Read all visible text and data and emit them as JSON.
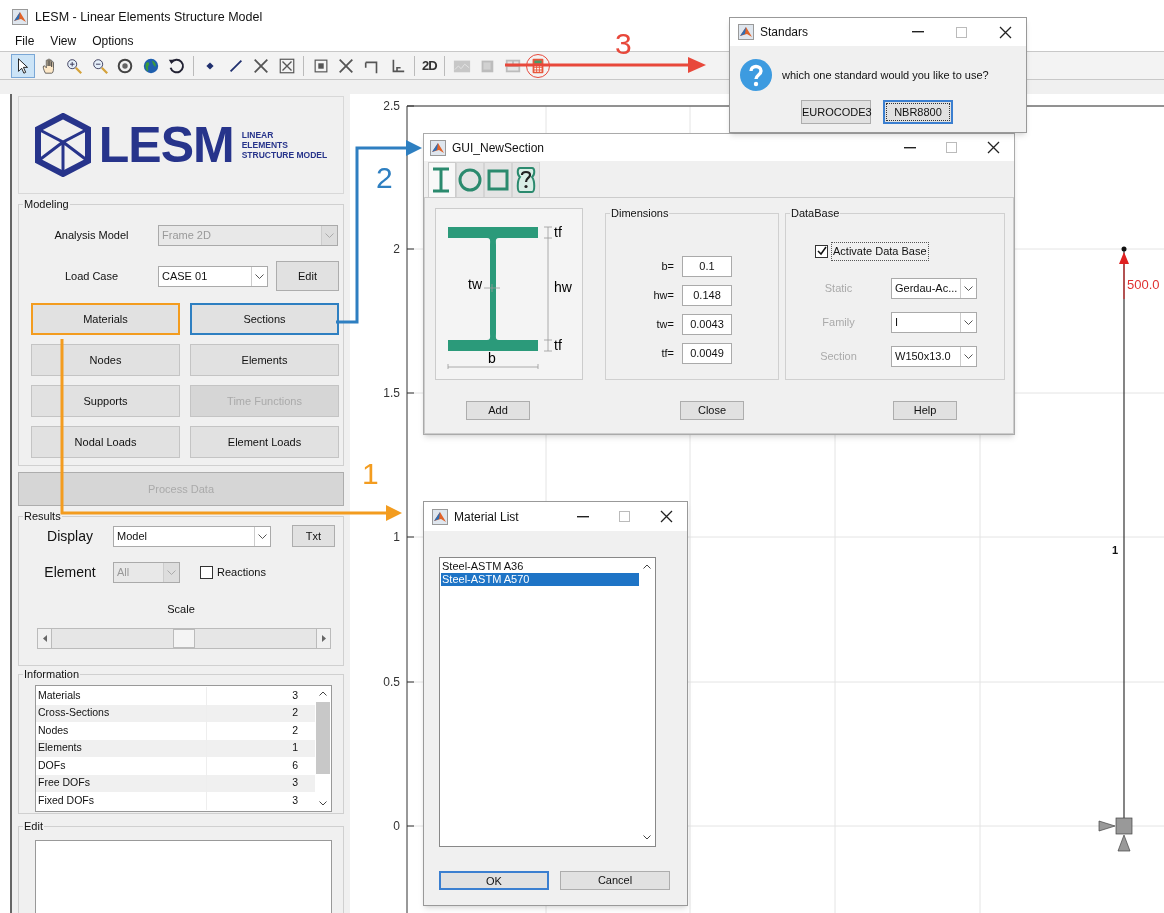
{
  "window": {
    "title": "LESM - Linear Elements Structure Model"
  },
  "menu": [
    "File",
    "View",
    "Options"
  ],
  "toolbar": [
    {
      "kind": "pointer",
      "selected": true,
      "disabled": false
    },
    {
      "kind": "pan",
      "selected": false,
      "disabled": false
    },
    {
      "kind": "zoom-in",
      "selected": false,
      "disabled": false
    },
    {
      "kind": "zoom-out",
      "selected": false,
      "disabled": false
    },
    {
      "kind": "rotate",
      "selected": false,
      "disabled": false
    },
    {
      "kind": "globe",
      "selected": false,
      "disabled": false
    },
    {
      "kind": "undo",
      "selected": false,
      "disabled": false
    },
    {
      "kind": "separator"
    },
    {
      "kind": "node",
      "selected": false,
      "disabled": false
    },
    {
      "kind": "line",
      "selected": false,
      "disabled": false
    },
    {
      "kind": "cross",
      "selected": false,
      "disabled": false
    },
    {
      "kind": "boxed-cross",
      "selected": false,
      "disabled": false
    },
    {
      "kind": "separator"
    },
    {
      "kind": "boxed-dot",
      "selected": false,
      "disabled": false
    },
    {
      "kind": "cross",
      "selected": false,
      "disabled": false
    },
    {
      "kind": "hinge",
      "selected": false,
      "disabled": false
    },
    {
      "kind": "fixed",
      "selected": false,
      "disabled": false
    },
    {
      "kind": "separator"
    },
    {
      "kind": "text",
      "label": "2D",
      "selected": false,
      "disabled": false
    },
    {
      "kind": "separator"
    },
    {
      "kind": "graph",
      "selected": false,
      "disabled": true
    },
    {
      "kind": "box",
      "selected": false,
      "disabled": true
    },
    {
      "kind": "panel",
      "selected": false,
      "disabled": true
    },
    {
      "kind": "calculator",
      "selected": false,
      "disabled": false
    }
  ],
  "logo": {
    "wordmark": "LESM",
    "tagline": [
      "LINEAR",
      "ELEMENTS",
      "STRUCTURE MODEL"
    ]
  },
  "modeling": {
    "title": "Modeling",
    "analysis_model": {
      "label": "Analysis Model",
      "value": "Frame 2D",
      "disabled": true
    },
    "load_case": {
      "label": "Load Case",
      "value": "CASE 01"
    },
    "edit_button": "Edit",
    "buttons": [
      {
        "label": "Materials",
        "disabled": false,
        "color": "#f39c1f"
      },
      {
        "label": "Sections",
        "disabled": false,
        "color": "#2e7fc1"
      },
      {
        "label": "Nodes",
        "disabled": false
      },
      {
        "label": "Elements",
        "disabled": false
      },
      {
        "label": "Supports",
        "disabled": false
      },
      {
        "label": "Time Functions",
        "disabled": true
      },
      {
        "label": "Nodal Loads",
        "disabled": false
      },
      {
        "label": "Element Loads",
        "disabled": false
      }
    ]
  },
  "process_button": {
    "label": "Process Data",
    "disabled": true
  },
  "results": {
    "title": "Results",
    "display": {
      "label": "Display",
      "value": "Model"
    },
    "txt_button": "Txt",
    "element": {
      "label": "Element",
      "value": "All",
      "disabled": true
    },
    "reactions": {
      "label": "Reactions",
      "checked": false
    },
    "scale": {
      "label": "Scale",
      "level": 0.5
    }
  },
  "information": {
    "title": "Information",
    "rows": [
      {
        "name": "Materials",
        "value": "3"
      },
      {
        "name": "Cross-Sections",
        "value": "2"
      },
      {
        "name": "Nodes",
        "value": "2"
      },
      {
        "name": "Elements",
        "value": "1"
      },
      {
        "name": "DOFs",
        "value": "6"
      },
      {
        "name": "Free DOFs",
        "value": "3"
      },
      {
        "name": "Fixed DOFs",
        "value": "3"
      }
    ]
  },
  "edit_panel": {
    "title": "Edit"
  },
  "plot": {
    "y_ticks": [
      "2.5",
      "2",
      "1.5",
      "1",
      "0.5",
      "0"
    ],
    "element_label": "1",
    "load_label": "500.0"
  },
  "section_dialog": {
    "title": "GUI_NewSection",
    "tabs": [
      {
        "kind": "i-beam",
        "selected": true
      },
      {
        "kind": "circle",
        "selected": false
      },
      {
        "kind": "square",
        "selected": false
      },
      {
        "kind": "help",
        "selected": false
      }
    ],
    "diagram_labels": {
      "top_flange": "tf",
      "web": "tw",
      "height": "hw",
      "bottom_flange": "tf",
      "width": "b"
    },
    "dimensions": {
      "title": "Dimensions",
      "fields": [
        {
          "label": "b=",
          "value": "0.1"
        },
        {
          "label": "hw=",
          "value": "0.148"
        },
        {
          "label": "tw=",
          "value": "0.0043"
        },
        {
          "label": "tf=",
          "value": "0.0049"
        }
      ]
    },
    "database": {
      "title": "DataBase",
      "activate": {
        "label": "Activate Data Base",
        "checked": true
      },
      "selects": [
        {
          "label": "Static",
          "value": "Gerdau-Ac..."
        },
        {
          "label": "Family",
          "value": "I"
        },
        {
          "label": "Section",
          "value": "W150x13.0"
        }
      ]
    },
    "buttons": [
      "Add",
      "Close",
      "Help"
    ]
  },
  "standards_dialog": {
    "title": "Standars",
    "message": "which one standard would you like to use?",
    "buttons": [
      {
        "label": "EUROCODE3",
        "focused": false
      },
      {
        "label": "NBR8800",
        "focused": true
      }
    ]
  },
  "material_dialog": {
    "title": "Material List",
    "items": [
      {
        "label": "Steel-ASTM A36",
        "selected": false
      },
      {
        "label": "Steel-ASTM A570",
        "selected": true
      }
    ],
    "buttons": [
      {
        "label": "OK",
        "focused": true
      },
      {
        "label": "Cancel",
        "focused": false
      }
    ]
  },
  "callouts": [
    {
      "number": "1",
      "color": "#f39c1f"
    },
    {
      "number": "2",
      "color": "#2e7fc1"
    },
    {
      "number": "3",
      "color": "#e8483b"
    }
  ]
}
